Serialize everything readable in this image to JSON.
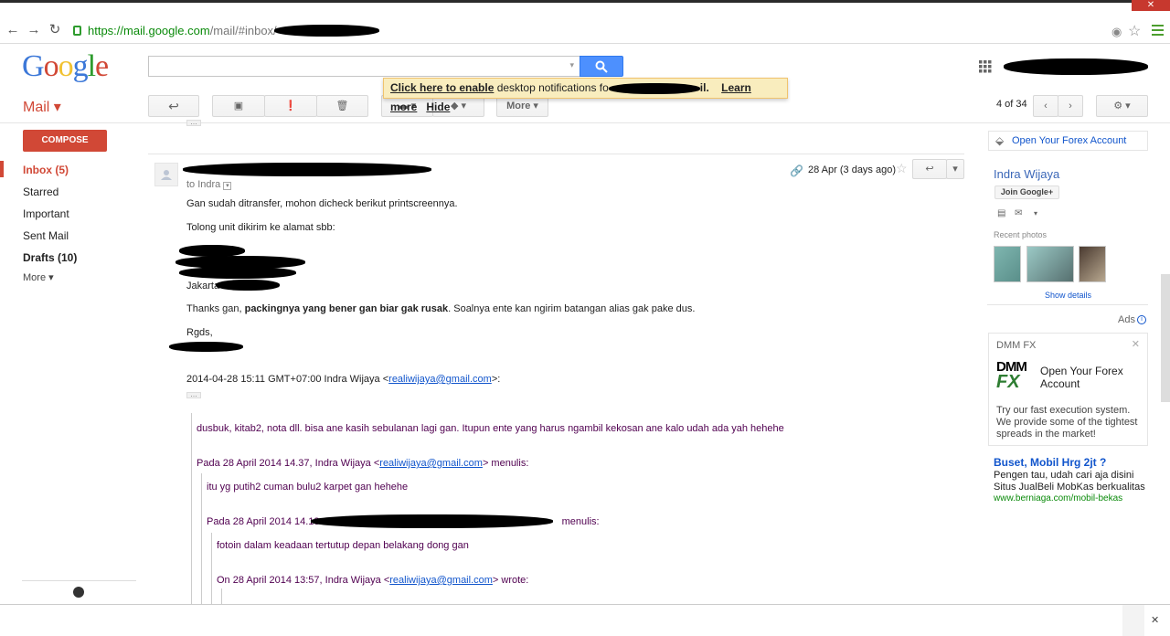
{
  "browser": {
    "url_host": "https://mail.google.com",
    "url_path": "/mail/#inbox/"
  },
  "logo": "Google",
  "header": {
    "mail_label": "Mail ▾"
  },
  "notification": {
    "enable_link": "Click here to enable",
    "text_before": " desktop notifications fo",
    "text_after": "il.",
    "learn_more": "Learn more",
    "hide": "Hide"
  },
  "toolbar": {
    "more_label": "More",
    "pager": "4 of 34"
  },
  "sidebar": {
    "compose": "COMPOSE",
    "items": [
      {
        "label": "Inbox (5)",
        "bold": true
      },
      {
        "label": "Starred",
        "bold": false
      },
      {
        "label": "Important",
        "bold": false
      },
      {
        "label": "Sent Mail",
        "bold": false
      },
      {
        "label": "Drafts (10)",
        "bold": true
      },
      {
        "label": "More ▾",
        "bold": false
      }
    ]
  },
  "message": {
    "to": "to Indra",
    "date": "28 Apr (3 days ago)",
    "line1": "Gan sudah ditransfer, mohon dicheck berikut printscreennya.",
    "line2": "Tolong unit dikirim ke alamat sbb:",
    "city": "Jakarta",
    "thanks_pre": "Thanks gan, ",
    "thanks_bold": "packingnya yang bener gan biar gak rusak",
    "thanks_post": ". Soalnya ente kan ngirim batangan alias gak pake dus.",
    "rgds": "Rgds,",
    "quote_header_pre": "2014-04-28 15:11 GMT+07:00 Indra Wijaya <",
    "email": "realiwijaya@gmail.com",
    "quote_header_post": ">:",
    "q1": "dusbuk, kitab2, nota dll. bisa ane kasih sebulanan lagi gan. Itupun ente yang harus ngambil kekosan ane kalo udah ada yah hehehe",
    "q2_pre": "Pada 28 April 2014 14.37, Indra Wijaya <",
    "q2_post": "> menulis:",
    "q3": "itu yg putih2 cuman bulu2 karpet gan hehehe",
    "q4_pre": "Pada 28 April 2014 14.18",
    "q4_post": " menulis:",
    "q5": "fotoin dalam keadaan tertutup depan belakang dong gan",
    "q6_pre": "On 28 April 2014 13:57, Indra Wijaya <",
    "q6_post": "> wrote:"
  },
  "right_pane": {
    "forex_top": "Open Your Forex Account",
    "contact_name": "Indra Wijaya",
    "join": "Join Google+",
    "recent_photos": "Recent photos",
    "show_details": "Show details",
    "ads": "Ads",
    "ad1": {
      "brand": "DMM FX",
      "title": "Open Your Forex Account",
      "body1": "Try our fast execution system.",
      "body2": "We provide some of the tightest",
      "body3": "spreads in the market!"
    },
    "ad2": {
      "title": "Buset, Mobil Hrg 2jt ?",
      "line1": "Pengen tau, udah cari aja disini",
      "line2": "Situs JualBeli MobKas berkualitas",
      "url": "www.berniaga.com/mobil-bekas"
    }
  },
  "colors": {
    "accent_red": "#d14836",
    "link_blue": "#1155cc",
    "quote_purple": "#500050",
    "notif_bg": "#f9edbe"
  }
}
